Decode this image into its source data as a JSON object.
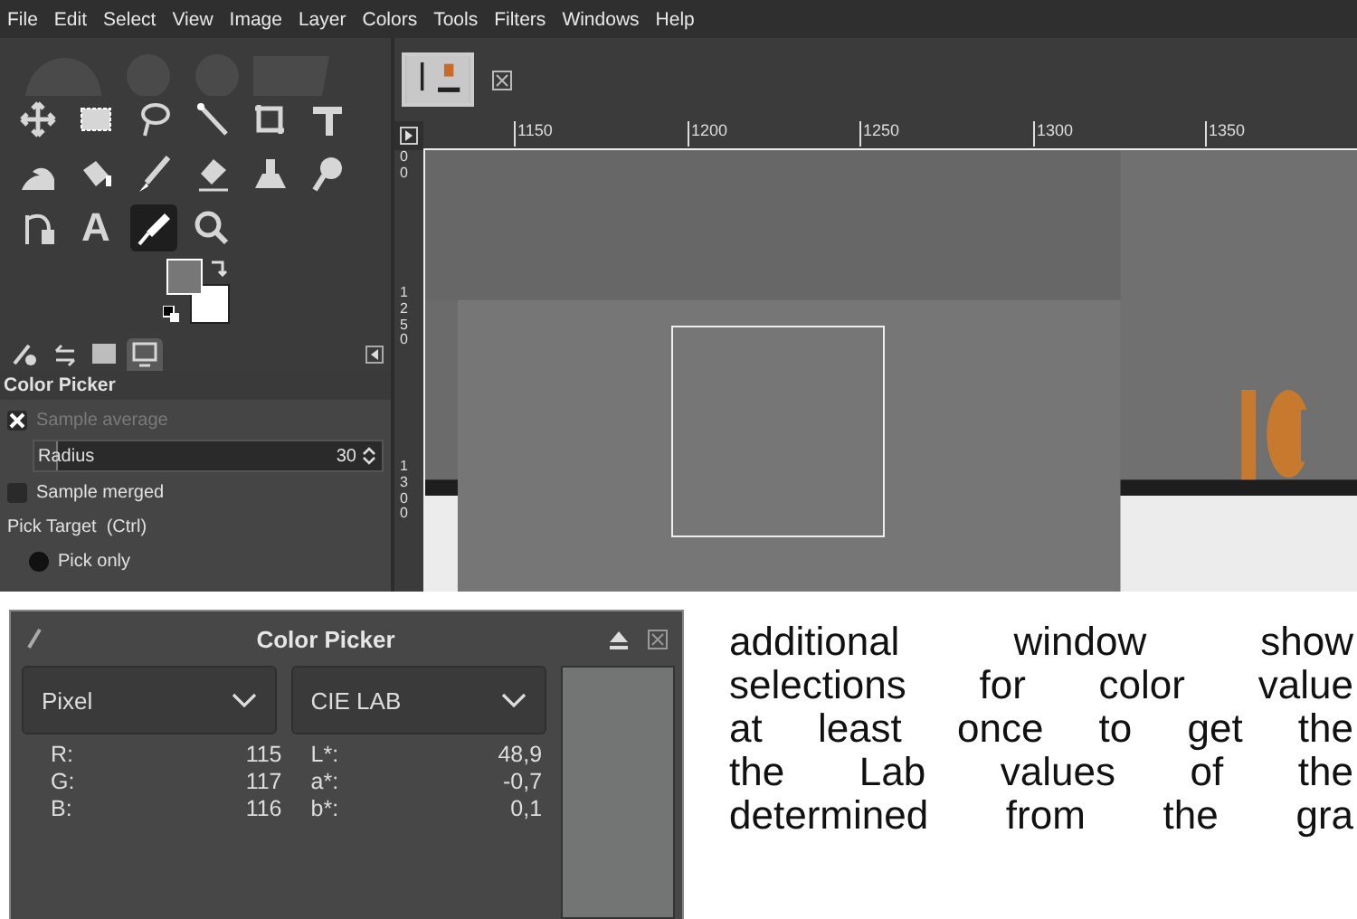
{
  "menu_bar": [
    "File",
    "Edit",
    "Select",
    "View",
    "Image",
    "Layer",
    "Colors",
    "Tools",
    "Filters",
    "Windows",
    "Help"
  ],
  "toolbox": {
    "tools": [
      {
        "kind": "move",
        "selected": false
      },
      {
        "kind": "rect-select",
        "selected": false
      },
      {
        "kind": "lasso",
        "selected": false
      },
      {
        "kind": "wand",
        "selected": false
      },
      {
        "kind": "crop",
        "selected": false
      },
      {
        "kind": "transform",
        "selected": false
      },
      {
        "kind": "warp",
        "selected": false
      },
      {
        "kind": "bucket",
        "selected": false
      },
      {
        "kind": "brush",
        "selected": false
      },
      {
        "kind": "eraser",
        "selected": false
      },
      {
        "kind": "clone",
        "selected": false
      },
      {
        "kind": "smudge",
        "selected": false
      },
      {
        "kind": "paths",
        "selected": false
      },
      {
        "kind": "text",
        "selected": false,
        "glyph": "A"
      },
      {
        "kind": "picker",
        "selected": true
      },
      {
        "kind": "zoom",
        "selected": false
      }
    ]
  },
  "dock_tabs": [
    {
      "kind": "options",
      "selected": false
    },
    {
      "kind": "undo",
      "selected": false
    },
    {
      "kind": "images",
      "selected": false
    },
    {
      "kind": "device",
      "selected": true
    }
  ],
  "tool_options": {
    "title": "Color Picker",
    "sample_average": {
      "label": "Sample average",
      "checked": true,
      "disabled": true
    },
    "radius": {
      "label": "Radius",
      "value": "30",
      "level": 0.06
    },
    "sample_merged": {
      "label": "Sample merged",
      "checked": false
    },
    "pick_target_label": "Pick Target  (Ctrl)",
    "pick_only": {
      "label": "Pick only",
      "selected": true
    }
  },
  "canvas": {
    "ruler_labels": [
      "1150",
      "1200",
      "1250",
      "1300",
      "1350"
    ],
    "vertical_ruler_labels": [
      "00",
      "1250",
      "1300"
    ]
  },
  "color_picker_dialog": {
    "title": "Color Picker",
    "dropdowns": [
      {
        "value": "Pixel"
      },
      {
        "value": "CIE LAB"
      }
    ],
    "pixel_rows": [
      {
        "label": "R:",
        "value": "115"
      },
      {
        "label": "G:",
        "value": "117"
      },
      {
        "label": "B:",
        "value": "116"
      }
    ],
    "lab_rows": [
      {
        "label": "L*:",
        "value": "48,9"
      },
      {
        "label": "a*:",
        "value": "-0,7"
      },
      {
        "label": "b*:",
        "value": "0,1"
      }
    ],
    "swatch": {
      "color": "#737574"
    }
  },
  "paragraph_lines": [
    "additional window show",
    "selections for color value",
    "at least once to get the",
    "the Lab values of the",
    "determined from the gra"
  ]
}
